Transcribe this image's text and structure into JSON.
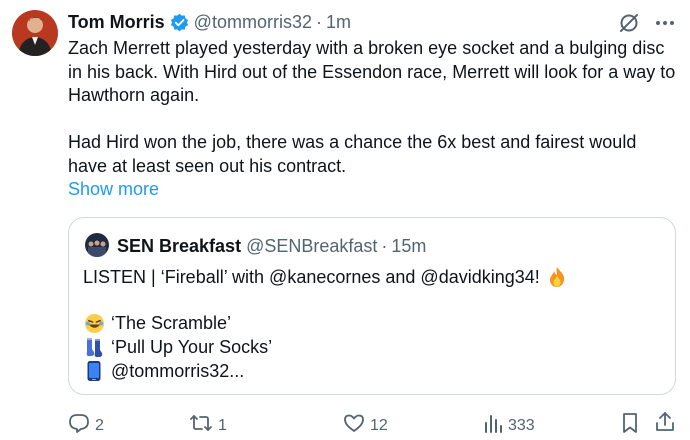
{
  "tweet": {
    "author_name": "Tom Morris",
    "handle": "@tommorris32",
    "separator": "·",
    "time": "1m",
    "text": "Zach Merrett played yesterday with a broken eye socket and a bulging disc in his back. With Hird out of the Essendon race, Merrett will look for a way to Hawthorn again.\n\nHad Hird won the job, there was a chance the 6x best and fairest would have at least seen out his contract.",
    "show_more": "Show more"
  },
  "quote": {
    "author_name": "SEN Breakfast",
    "handle": "@SENBreakfast",
    "separator": "·",
    "time": "15m",
    "line1": "LISTEN | ‘Fireball’ with @kanecornes and @davidking34!",
    "line2": "‘The Scramble’",
    "line3": "‘Pull Up Your Socks’",
    "line4": "@tommorris32..."
  },
  "actions": {
    "replies": "2",
    "reposts": "1",
    "likes": "12",
    "views": "333"
  },
  "icons": {
    "verified": "verified-badge-icon",
    "grok": "grok-icon",
    "more": "more-options-icon",
    "reply": "reply-icon",
    "repost": "repost-icon",
    "like": "like-icon",
    "views": "views-icon",
    "bookmark": "bookmark-icon",
    "share": "share-icon",
    "fire": "fire-emoji",
    "laugh": "laughing-emoji",
    "socks": "socks-emoji",
    "phone": "phone-emoji"
  },
  "colors": {
    "accent": "#1d9bf0",
    "text": "#0f1419",
    "secondary": "#536471",
    "border": "#cfd9de"
  }
}
